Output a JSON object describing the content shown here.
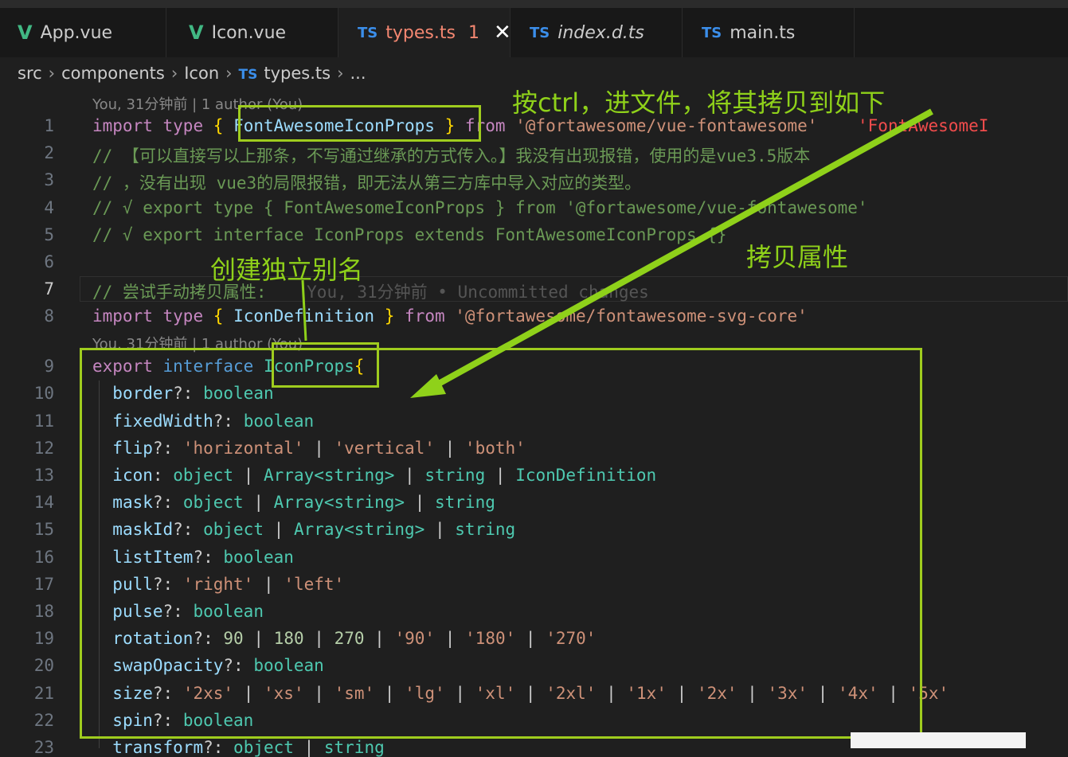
{
  "tabs": [
    {
      "icon": "V",
      "label": "App.vue",
      "type": "vue"
    },
    {
      "icon": "V",
      "label": "Icon.vue",
      "type": "vue"
    },
    {
      "icon": "TS",
      "label": "types.ts",
      "type": "ts",
      "problems": "1",
      "active": true
    },
    {
      "icon": "TS",
      "label": "index.d.ts",
      "type": "ts"
    },
    {
      "icon": "TS",
      "label": "main.ts",
      "type": "ts"
    }
  ],
  "breadcrumb": {
    "items": [
      "src",
      "components",
      "Icon"
    ],
    "file_icon": "TS",
    "file": "types.ts",
    "more": "..."
  },
  "codelens": {
    "top": "You, 31分钟前 | 1 author (You)",
    "mid": "You, 31分钟前 | 1 author (You)"
  },
  "lines": {
    "l1": {
      "n": "1",
      "a": "import",
      "b": "type",
      "c": "{",
      "d": "FontAwesomeIconProps",
      "e": "}",
      "f": "from",
      "g": "'@fortawesome/vue-fontawesome'",
      "h": "'FontAwesomeI"
    },
    "l2": {
      "n": "2",
      "t": "// 【可以直接写以上那条，不写通过继承的方式传入。】我没有出现报错，使用的是vue3.5版本"
    },
    "l3": {
      "n": "3",
      "t": "// ，没有出现 vue3的局限报错，即无法从第三方库中导入对应的类型。"
    },
    "l4": {
      "n": "4",
      "t": "// √ export type { FontAwesomeIconProps } from '@fortawesome/vue-fontawesome'"
    },
    "l5": {
      "n": "5",
      "t": "// √ export interface IconProps extends FontAwesomeIconProps {}"
    },
    "l6": {
      "n": "6"
    },
    "l7": {
      "n": "7",
      "t": "// 尝试手动拷贝属性:",
      "ghost": "You, 31分钟前 • Uncommitted changes"
    },
    "l8": {
      "n": "8",
      "a": "import",
      "b": "type",
      "c": "{",
      "d": "IconDefinition",
      "e": "}",
      "f": "from",
      "g": "'@fortawesome/fontawesome-svg-core'"
    },
    "l9": {
      "n": "9",
      "a": "export",
      "b": "interface",
      "c": "IconProps",
      "d": "{"
    },
    "l10": {
      "n": "10",
      "p": "border",
      "q": "?:",
      "t": "boolean"
    },
    "l11": {
      "n": "11",
      "p": "fixedWidth",
      "q": "?:",
      "t": "boolean"
    },
    "l12": {
      "n": "12",
      "p": "flip",
      "q": "?:",
      "s1": "'horizontal'",
      "s2": "'vertical'",
      "s3": "'both'",
      "pipe": "|"
    },
    "l13": {
      "n": "13",
      "p": "icon",
      "q": ":",
      "t1": "object",
      "t2": "Array",
      "t3": "<string>",
      "t4": "string",
      "t5": "IconDefinition",
      "pipe": "|"
    },
    "l14": {
      "n": "14",
      "p": "mask",
      "q": "?:",
      "t1": "object",
      "t2": "Array",
      "t3": "<string>",
      "t4": "string",
      "pipe": "|"
    },
    "l15": {
      "n": "15",
      "p": "maskId",
      "q": "?:",
      "t1": "object",
      "t2": "Array",
      "t3": "<string>",
      "t4": "string",
      "pipe": "|"
    },
    "l16": {
      "n": "16",
      "p": "listItem",
      "q": "?:",
      "t": "boolean"
    },
    "l17": {
      "n": "17",
      "p": "pull",
      "q": "?:",
      "s1": "'right'",
      "s2": "'left'",
      "pipe": "|"
    },
    "l18": {
      "n": "18",
      "p": "pulse",
      "q": "?:",
      "t": "boolean"
    },
    "l19": {
      "n": "19",
      "p": "rotation",
      "q": "?:",
      "n1": "90",
      "n2": "180",
      "n3": "270",
      "s1": "'90'",
      "s2": "'180'",
      "s3": "'270'",
      "pipe": "|"
    },
    "l20": {
      "n": "20",
      "p": "swapOpacity",
      "q": "?:",
      "t": "boolean"
    },
    "l21": {
      "n": "21",
      "p": "size",
      "q": "?:",
      "vals": [
        "'2xs'",
        "'xs'",
        "'sm'",
        "'lg'",
        "'xl'",
        "'2xl'",
        "'1x'",
        "'2x'",
        "'3x'",
        "'4x'",
        "'5x'"
      ],
      "pipe": "|"
    },
    "l22": {
      "n": "22",
      "p": "spin",
      "q": "?:",
      "t": "boolean"
    },
    "l23": {
      "n": "23",
      "p": "transform",
      "q": "?:",
      "t1": "object",
      "t2": "string",
      "pipe": "|"
    }
  },
  "annotations": {
    "ctrl_note": "按ctrl，进文件，将其拷贝到如下",
    "alias_note": "创建独立别名",
    "copy_note": "拷贝属性"
  },
  "colors": {
    "accent": "#9fcc1e",
    "keyword": "#569cd6",
    "control": "#c586c0",
    "type": "#4ec9b0",
    "string": "#ce9178",
    "comment": "#6a9955"
  }
}
